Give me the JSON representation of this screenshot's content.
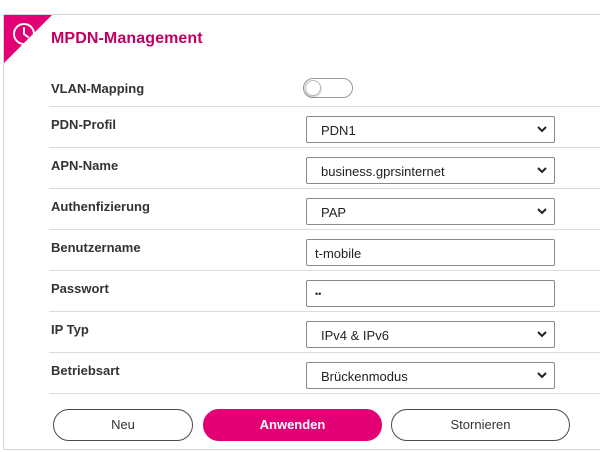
{
  "header": {
    "title": "MPDN-Management",
    "icon": "clock-icon"
  },
  "accent_color": "#e20074",
  "form": {
    "vlan": {
      "label": "VLAN-Mapping",
      "enabled": false
    },
    "pdn_profile": {
      "label": "PDN-Profil",
      "value": "PDN1"
    },
    "apn_name": {
      "label": "APN-Name",
      "value": "business.gprsinternet"
    },
    "auth": {
      "label": "Authenfizierung",
      "value": "PAP"
    },
    "username": {
      "label": "Benutzername",
      "value": "t-mobile"
    },
    "password": {
      "label": "Passwort",
      "value": "••"
    },
    "ip_type": {
      "label": "IP Typ",
      "value": "IPv4 & IPv6"
    },
    "mode": {
      "label": "Betriebsart",
      "value": "Brückenmodus"
    }
  },
  "buttons": {
    "new": "Neu",
    "apply": "Anwenden",
    "cancel": "Stornieren"
  }
}
